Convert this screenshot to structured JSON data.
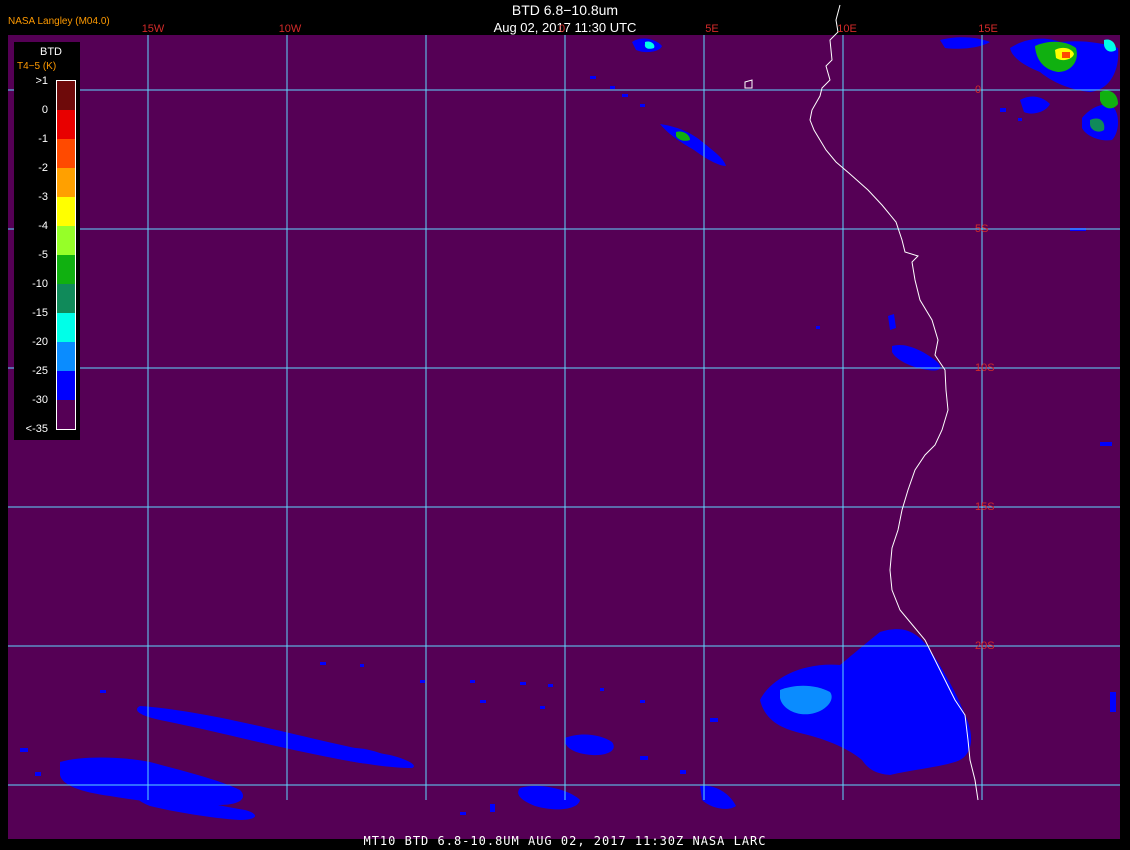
{
  "header": {
    "title": "BTD 6.8−10.8um",
    "subtitle": "Aug 02, 2017 11:30 UTC",
    "credit": "NASA Langley (M04.0)"
  },
  "footer": {
    "text": "MT10  BTD 6.8-10.8UM  AUG 02, 2017 11:30Z  NASA LARC"
  },
  "legend": {
    "label1": "BTD",
    "label2": "T4−5 (K)",
    "ticks": [
      ">1",
      "0",
      "-1",
      "-2",
      "-3",
      "-4",
      "-5",
      "-10",
      "-15",
      "-20",
      "-25",
      "-30",
      "<-35"
    ],
    "colors": [
      "#6e0a0a",
      "#e80000",
      "#ff4a00",
      "#ffa000",
      "#ffff00",
      "#96ff28",
      "#10b010",
      "#108a5a",
      "#00ffe8",
      "#0a8cff",
      "#0000ff",
      "#550055"
    ]
  },
  "grid": {
    "lon_labels": [
      "15W",
      "10W",
      "0",
      "5E",
      "10E",
      "15E"
    ],
    "lat_labels": [
      "0",
      "5S",
      "10S",
      "15S",
      "20S"
    ]
  },
  "colors": {
    "background": "#550055",
    "grid": "#5fd8ff",
    "coast": "#ffffff",
    "cloud": "#0000ff",
    "cloud_light": "#0a8cff",
    "label": "#d42a2a"
  }
}
